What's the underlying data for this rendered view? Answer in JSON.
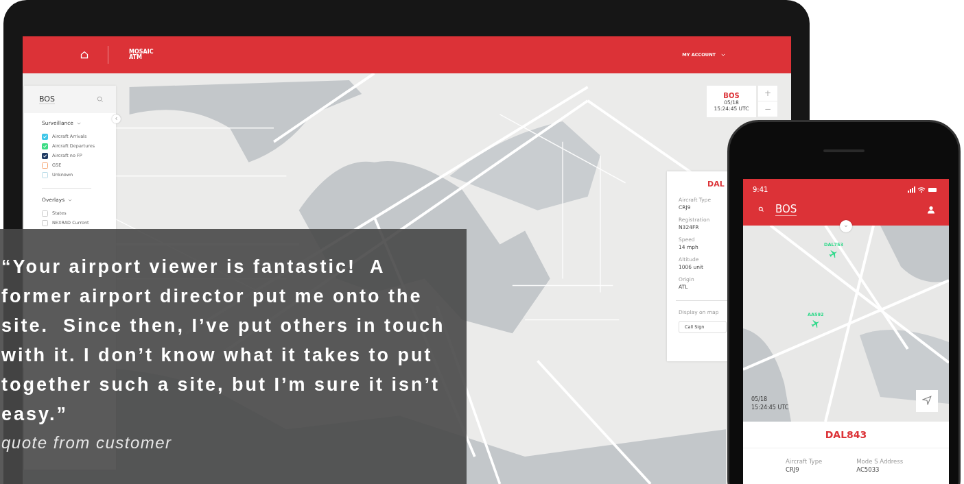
{
  "laptop": {
    "header": {
      "logo_lines": [
        "MOSAIC",
        "ATM"
      ],
      "account_menu": "MY ACCOUNT"
    },
    "sidebar": {
      "title": "BOS",
      "sections": [
        {
          "title": "Surveillance",
          "items": [
            {
              "label": "Aircraft Arrivals",
              "checked": true,
              "color": "#3ec6e8"
            },
            {
              "label": "Aircraft Departures",
              "checked": true,
              "color": "#3ddc84"
            },
            {
              "label": "Aircraft no FP",
              "checked": true,
              "color": "#1f3b63"
            },
            {
              "label": "GSE",
              "checked": false,
              "color": "#f5a06a"
            },
            {
              "label": "Unknown",
              "checked": false,
              "color": "#b7dbe8"
            }
          ]
        },
        {
          "title": "Overlays",
          "items": [
            {
              "label": "States",
              "checked": false,
              "color": "#c8c8c8"
            },
            {
              "label": "NEXRAD Current",
              "checked": false,
              "color": "#c8c8c8"
            }
          ]
        }
      ]
    },
    "collapse_glyph": "‹",
    "airport_card": {
      "code": "BOS",
      "date": "05/18",
      "time": "15:24:45 UTC"
    },
    "zoom_controls": [
      "+",
      "−"
    ],
    "flight_panel": {
      "callsign": "DAL",
      "fields": [
        {
          "label": "Aircraft Type",
          "value": "CRJ9"
        },
        {
          "label": "Registration",
          "value": "N324FR"
        },
        {
          "label": "Speed",
          "value": "14 mph"
        },
        {
          "label": "Altitude",
          "value": "1006 unit"
        },
        {
          "label": "Origin",
          "value": "ATL"
        }
      ],
      "display_label": "Display on map",
      "display_value": "Call Sign"
    }
  },
  "phone": {
    "time": "9:41",
    "search_value": "BOS",
    "expand_glyph": "⌄",
    "pins": [
      {
        "label": "DAL753"
      },
      {
        "label": "AA592"
      }
    ],
    "date": "05/18",
    "time_utc": "15:24:45 UTC",
    "flight": {
      "callsign": "DAL843",
      "fields": [
        {
          "label": "Aircraft Type",
          "value": "CRJ9"
        },
        {
          "label": "Mode S Address",
          "value": "AC5033"
        }
      ]
    }
  },
  "quote": {
    "text": "“Your airport viewer is fantastic!  A former airport director put me onto the site.  Since then, I’ve put others in touch with it. I don’t know what it takes to put together such a site, but I’m sure it isn’t easy.”",
    "attribution": "quote from customer"
  }
}
